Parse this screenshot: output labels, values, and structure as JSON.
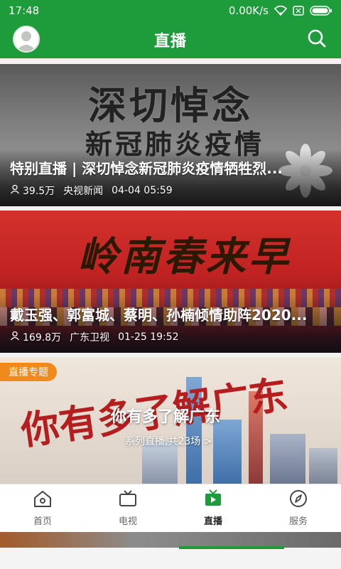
{
  "status_bar": {
    "time": "17:48",
    "network_speed": "0.00K/s",
    "icons": [
      "wifi-icon",
      "no-sim-icon",
      "battery-icon"
    ]
  },
  "header": {
    "title": "直播",
    "left_icon": "avatar",
    "right_icon": "search-icon"
  },
  "colors": {
    "brand_green": "#1e9b3a",
    "badge_orange": "#f08a1c"
  },
  "cards": [
    {
      "background_text_1": "深切悼念",
      "background_text_2": "新冠肺炎疫情",
      "title": "特别直播 | 深切悼念新冠肺炎疫情牺牲烈...",
      "viewers": "39.5万",
      "channel": "央视新闻",
      "time": "04-04 05:59"
    },
    {
      "background_text_1": "岭南春来早",
      "title": "戴玉强、郭富城、蔡明、孙楠倾情助阵2020...",
      "viewers": "169.8万",
      "channel": "广东卫视",
      "time": "01-25 19:52"
    },
    {
      "badge": "直播专题",
      "calligraphy": "你有多了解广东",
      "title": "你有多了解广东",
      "subtitle": "系列直播,共23场 >"
    }
  ],
  "bottom_nav": [
    {
      "label": "首页",
      "icon": "home-icon",
      "active": false
    },
    {
      "label": "电视",
      "icon": "tv-icon",
      "active": false
    },
    {
      "label": "直播",
      "icon": "live-icon",
      "active": true
    },
    {
      "label": "服务",
      "icon": "compass-icon",
      "active": false
    }
  ]
}
